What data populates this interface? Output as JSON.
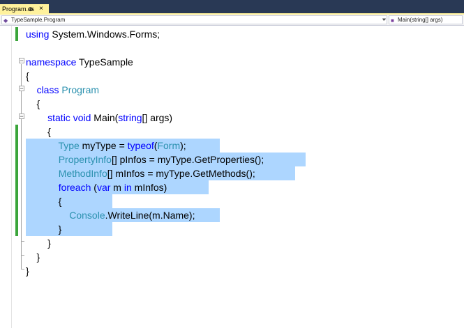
{
  "tab": {
    "filename": "Program.cs",
    "pin_glyph": "⊕",
    "close_glyph": "×"
  },
  "navbar": {
    "left_label": "TypeSample.Program",
    "right_label": "Main(string[] args)",
    "arrow_glyph": "▾",
    "class_icon": "class-icon",
    "method_icon": "method-icon"
  },
  "code": {
    "lines": [
      [
        {
          "t": "using",
          "c": "kw"
        },
        {
          "t": " System.Windows.Forms;",
          "c": ""
        }
      ],
      [],
      [
        {
          "t": "namespace",
          "c": "kw"
        },
        {
          "t": " TypeSample",
          "c": ""
        }
      ],
      [
        {
          "t": "{",
          "c": ""
        }
      ],
      [
        {
          "t": "    ",
          "c": ""
        },
        {
          "t": "class",
          "c": "kw"
        },
        {
          "t": " ",
          "c": ""
        },
        {
          "t": "Program",
          "c": "ty"
        }
      ],
      [
        {
          "t": "    {",
          "c": ""
        }
      ],
      [
        {
          "t": "        ",
          "c": ""
        },
        {
          "t": "static",
          "c": "kw"
        },
        {
          "t": " ",
          "c": ""
        },
        {
          "t": "void",
          "c": "kw"
        },
        {
          "t": " Main(",
          "c": ""
        },
        {
          "t": "string",
          "c": "kw"
        },
        {
          "t": "[] args)",
          "c": ""
        }
      ],
      [
        {
          "t": "        {",
          "c": ""
        }
      ],
      [
        {
          "t": "            ",
          "c": ""
        },
        {
          "t": "Type",
          "c": "ty"
        },
        {
          "t": " myType = ",
          "c": ""
        },
        {
          "t": "typeof",
          "c": "kw"
        },
        {
          "t": "(",
          "c": ""
        },
        {
          "t": "Form",
          "c": "ty"
        },
        {
          "t": ");",
          "c": ""
        }
      ],
      [
        {
          "t": "            ",
          "c": ""
        },
        {
          "t": "PropertyInfo",
          "c": "ty"
        },
        {
          "t": "[] pInfos = myType.GetProperties();",
          "c": ""
        }
      ],
      [
        {
          "t": "            ",
          "c": ""
        },
        {
          "t": "MethodInfo",
          "c": "ty"
        },
        {
          "t": "[] mInfos = myType.GetMethods();",
          "c": ""
        }
      ],
      [
        {
          "t": "            ",
          "c": ""
        },
        {
          "t": "foreach",
          "c": "kw"
        },
        {
          "t": " (",
          "c": ""
        },
        {
          "t": "var",
          "c": "kw"
        },
        {
          "t": " m ",
          "c": ""
        },
        {
          "t": "in",
          "c": "kw"
        },
        {
          "t": " mInfos)",
          "c": ""
        }
      ],
      [
        {
          "t": "            {",
          "c": ""
        }
      ],
      [
        {
          "t": "                ",
          "c": ""
        },
        {
          "t": "Console",
          "c": "ty"
        },
        {
          "t": ".WriteLine(m.Name);",
          "c": ""
        }
      ],
      [
        {
          "t": "            }",
          "c": ""
        }
      ],
      [
        {
          "t": "        }",
          "c": ""
        }
      ],
      [
        {
          "t": "    }",
          "c": ""
        }
      ],
      [
        {
          "t": "}",
          "c": ""
        }
      ]
    ],
    "changed_lines": [
      0,
      7,
      8,
      9,
      10,
      11,
      12,
      13,
      14
    ],
    "selection": [
      {
        "line": 8,
        "width_chars": 36
      },
      {
        "line": 9,
        "width_chars": 52
      },
      {
        "line": 10,
        "width_chars": 50
      },
      {
        "line": 11,
        "width_chars": 34
      },
      {
        "line": 12,
        "width_chars": 16
      },
      {
        "line": 13,
        "width_chars": 36
      },
      {
        "line": 14,
        "width_chars": 16
      }
    ],
    "colors": {
      "keyword": "#0000ff",
      "type": "#2b91af",
      "selection": "#add6ff",
      "change_bar": "#3ba53b"
    }
  }
}
